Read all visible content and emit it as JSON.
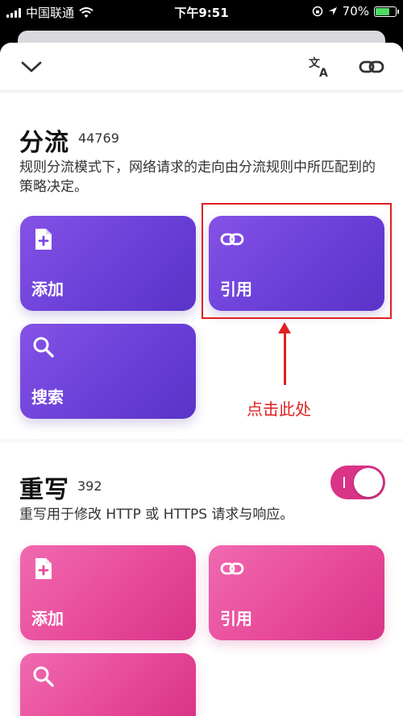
{
  "status_bar": {
    "carrier": "中国联通",
    "time": "下午9:51",
    "battery_percent": "70%",
    "battery_level": 0.7
  },
  "nav": {
    "collapse_icon": "chevron-down-icon",
    "translate_icon": "translate-icon",
    "link_icon": "link-icon"
  },
  "routing": {
    "title": "分流",
    "count": "44769",
    "description": "规则分流模式下，网络请求的走向由分流规则中所匹配到的策略决定。",
    "tiles": {
      "add": "添加",
      "reference": "引用",
      "search": "搜索"
    }
  },
  "rewrite": {
    "title": "重写",
    "count": "392",
    "enabled": true,
    "description": "重写用于修改 HTTP 或 HTTPS 请求与响应。",
    "tiles": {
      "add": "添加",
      "reference": "引用"
    }
  },
  "annotation": {
    "text": "点击此处",
    "color": "#e02020"
  },
  "colors": {
    "purple": "#6a3fd8",
    "pink": "#e84a9a"
  }
}
